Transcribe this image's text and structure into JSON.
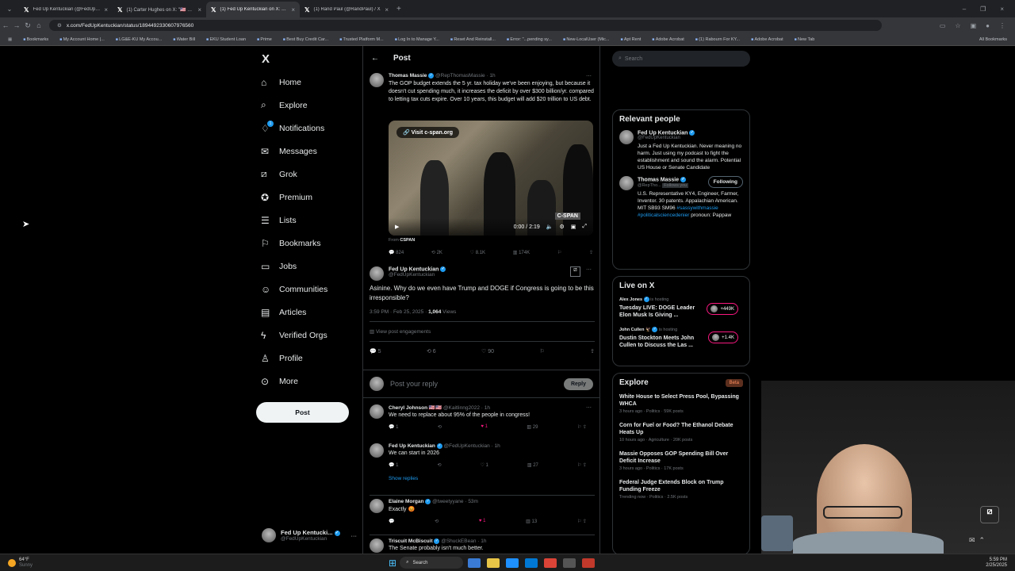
{
  "browser": {
    "tabs": [
      {
        "title": "Fed Up Kentuckian (@FedUpK..."
      },
      {
        "title": "(1) Carter Hughes on X: \"🇺🇸 BR..."
      },
      {
        "title": "(1) Fed Up Kentuckian on X: \"@..."
      },
      {
        "title": "(1) Rand Paul (@RandPaul) / X"
      }
    ],
    "url": "x.com/FedUpKentuckian/status/1894492330607976560",
    "bookmarks": [
      "Bookmarks",
      "My Account Home |...",
      "LG&E-KU My Accou...",
      "Water Bill",
      "EKU Student Loan",
      "Prime",
      "Best Buy Credit Car...",
      "Trusted Platform M...",
      "Log In to Manage Y...",
      "Reset And Reinstall...",
      "Error: \"...pending sy...",
      "New-LocalUser (Mic...",
      "Apt Rent",
      "Adobe Acrobat",
      "(1) Rabourn For KY...",
      "Adobe Acrobat",
      "New Tab"
    ],
    "all_bookmarks": "All Bookmarks"
  },
  "nav": {
    "logo": "X",
    "items": [
      "Home",
      "Explore",
      "Notifications",
      "Messages",
      "Grok",
      "Premium",
      "Lists",
      "Bookmarks",
      "Jobs",
      "Communities",
      "Articles",
      "Verified Orgs",
      "Profile",
      "More"
    ],
    "notif_count": "1",
    "post_button": "Post",
    "account": {
      "name": "Fed Up Kentucki...",
      "handle": "@FedUpKentuckian"
    }
  },
  "main": {
    "header": "Post",
    "quoted": {
      "name": "Thomas Massie",
      "handle": "@RepThomasMassie · 1h",
      "text": "The GOP budget extends the 5 yr. tax holiday we've been enjoying, but because it doesn't cut spending much, it increases the deficit by over $300 billion/yr. compared to letting tax cuts expire. Over 10 years, this budget will add $20 trillion to US debt.",
      "visit": "Visit c-span.org",
      "time": "0:00 / 2:19",
      "cspan": "C-SPAN",
      "from": "From",
      "from_src": "CSPAN",
      "stats": [
        "824",
        "2K",
        "8.1K",
        "174K"
      ]
    },
    "post": {
      "name": "Fed Up Kentuckian",
      "handle": "@FedUpKentuckian",
      "text": "Asinine.  Why do we even have Trump and DOGE if Congress is going to be this irresponsible?",
      "date": "3:59 PM · Feb 25, 2025 · ",
      "views_num": "1,064",
      "views_label": " Views",
      "engagements": "View post engagements",
      "stats": [
        "5",
        "6",
        "90"
      ]
    },
    "reply_box": {
      "placeholder": "Post your reply",
      "button": "Reply"
    },
    "replies": [
      {
        "name": "Cheryl Johnson 🇺🇸🇺🇸",
        "handle": "@Kaitlinng2022 · 1h",
        "text": "We need to replace about 95% of the people in congress!",
        "stats": [
          "1",
          "",
          "1",
          "29"
        ]
      },
      {
        "name": "Fed Up Kentuckian",
        "handle": "@FedUpKentuckian · 1h",
        "text": "We can start in 2026",
        "stats": [
          "1",
          "",
          "1",
          "27"
        ]
      },
      {
        "name": "Elaine Morgan",
        "handle": "@tweetyyane · 53m",
        "text": "Exactly 😡",
        "stats": [
          "",
          "",
          "1",
          "13"
        ]
      },
      {
        "name": "Triscuit McBiscuit",
        "handle": "@ShuckEBean · 1h",
        "text": "The Senate probably isn't much better.",
        "stats": []
      }
    ],
    "show_replies": "Show replies"
  },
  "right": {
    "search_placeholder": "Search",
    "relevant_title": "Relevant people",
    "people": [
      {
        "name": "Fed Up Kentuckian",
        "handle": "@FedUpKentuckian",
        "bio": "Just a Fed Up Kentuckian. Never meaning no harm. Just using my podcast to fight the establishment and sound the alarm. Potential US House or Senate Candidate"
      },
      {
        "name": "Thomas Massie",
        "handle": "@RepTho...",
        "follows": "Follows you",
        "button": "Following",
        "bio": "U.S. Representative KY4, Engineer, Farmer, Inventor. 30 patents. Appalachian American. MIT SB93 SM96 ",
        "tags": "#sassywithmassie #politicalsciencedenier",
        "bio2": " pronoun: Pappaw"
      }
    ],
    "live_title": "Live on X",
    "live": [
      {
        "host": "Alex Jones",
        "status": "is hosting",
        "title": "Tuesday LIVE: DOGE Leader Elon Musk Is Giving ...",
        "count": "+449K"
      },
      {
        "host": "John Cullen 🦅",
        "status": "is hosting",
        "title": "Dustin Stockton Meets John Cullen to Discuss the Las ...",
        "count": "+1.4K"
      }
    ],
    "explore_title": "Explore",
    "beta": "Beta",
    "explore": [
      {
        "title": "White House to Select Press Pool, Bypassing WHCA",
        "meta": "3 hours ago · Politics · 59K posts"
      },
      {
        "title": "Corn for Fuel or Food? The Ethanol Debate Heats Up",
        "meta": "10 hours ago · Agriculture · 20K posts"
      },
      {
        "title": "Massie Opposes GOP Spending Bill Over Deficit Increase",
        "meta": "3 hours ago · Politics · 17K posts"
      },
      {
        "title": "Federal Judge Extends Block on Trump Funding Freeze",
        "meta": "Trending now · Politics · 2.5K posts"
      }
    ]
  },
  "taskbar": {
    "weather": "64°F",
    "weather_sub": "Sunny",
    "search": "Search",
    "time": "5:59 PM",
    "date": "2/25/2025"
  }
}
